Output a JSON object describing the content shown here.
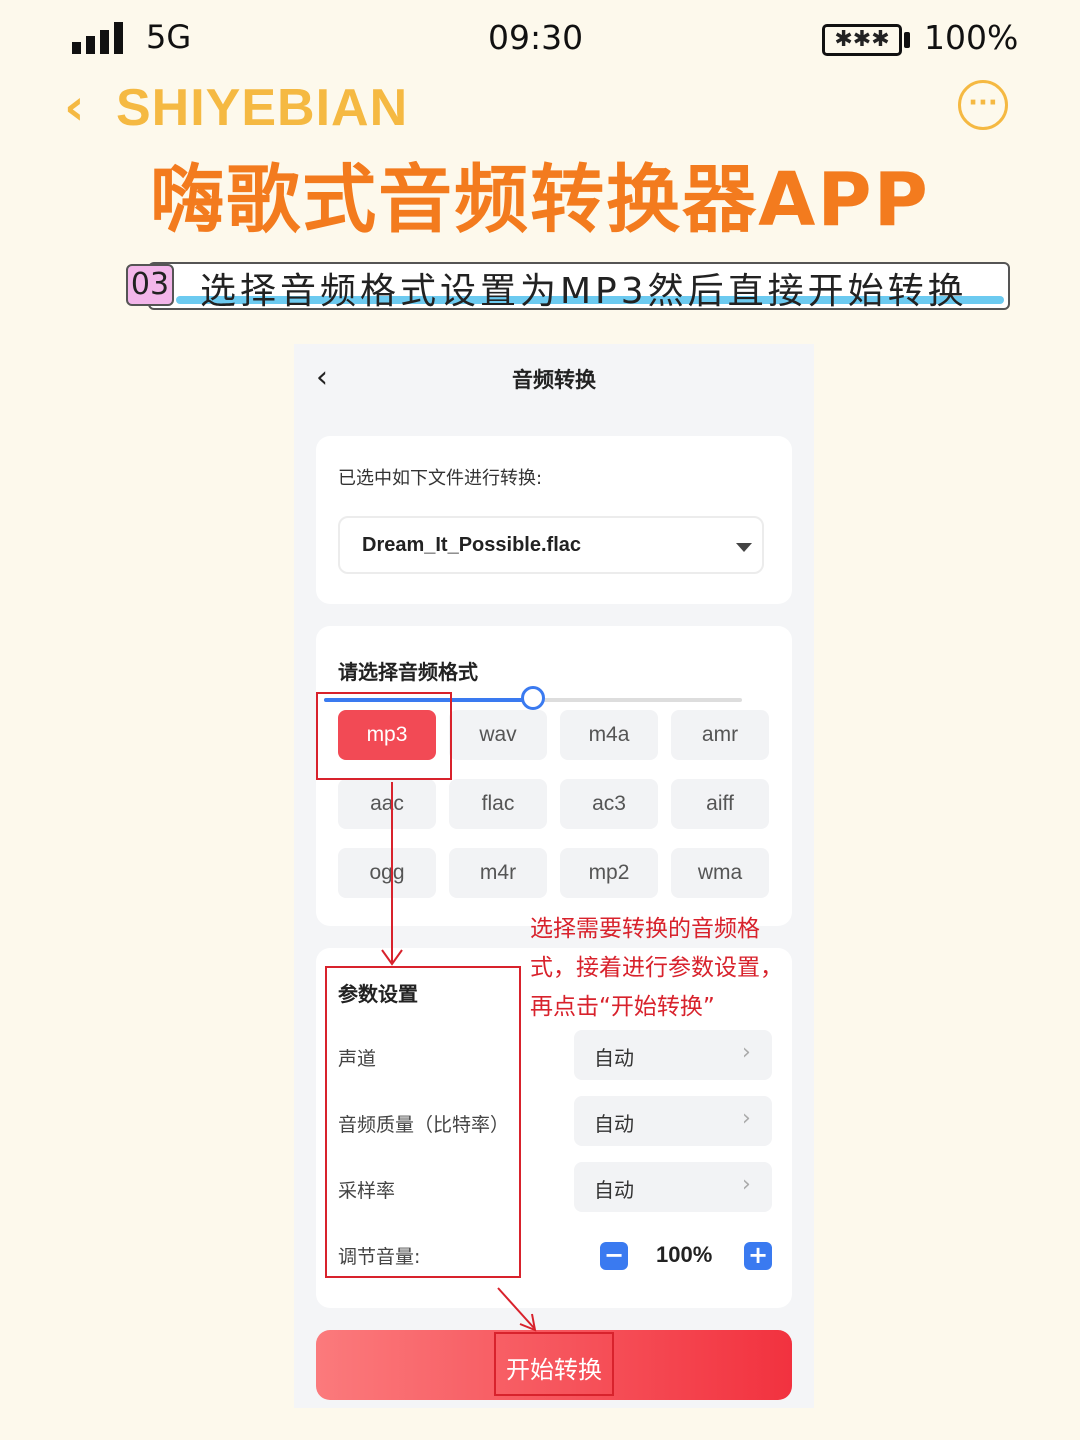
{
  "status_bar": {
    "network": "5G",
    "time": "09:30",
    "battery_percent": "100%"
  },
  "header": {
    "brand": "SHIYEBIAN",
    "back_icon": "chevron-left-icon",
    "more_icon": "more-dots-icon",
    "title": "嗨歌式音频转换器APP"
  },
  "step": {
    "number": "03",
    "text": "选择音频格式设置为MP3然后直接开始转换"
  },
  "app": {
    "title": "音频转换",
    "file_section": {
      "label": "已选中如下文件进行转换:",
      "selected_file": "Dream_It_Possible.flac"
    },
    "format_section": {
      "label": "请选择音频格式",
      "formats": [
        "mp3",
        "wav",
        "m4a",
        "amr",
        "aac",
        "flac",
        "ac3",
        "aiff",
        "ogg",
        "m4r",
        "mp2",
        "wma"
      ],
      "selected": "mp3"
    },
    "params": {
      "label": "参数设置",
      "items": [
        {
          "label": "声道",
          "value": "自动"
        },
        {
          "label": "音频质量（比特率）",
          "value": "自动"
        },
        {
          "label": "采样率",
          "value": "自动"
        }
      ],
      "volume_label": "调节音量:",
      "volume_value": "100%",
      "volume_level": 0.5
    },
    "start_button": "开始转换"
  },
  "annotation": {
    "text": "选择需要转换的音频格式，接着进行参数设置，再点击“开始转换”"
  },
  "colors": {
    "accent_orange": "#f37b1e",
    "brand_yellow": "#f5b942",
    "active_red": "#f24a55",
    "annotation_red": "#d8222c",
    "slider_blue": "#3a7af0"
  }
}
